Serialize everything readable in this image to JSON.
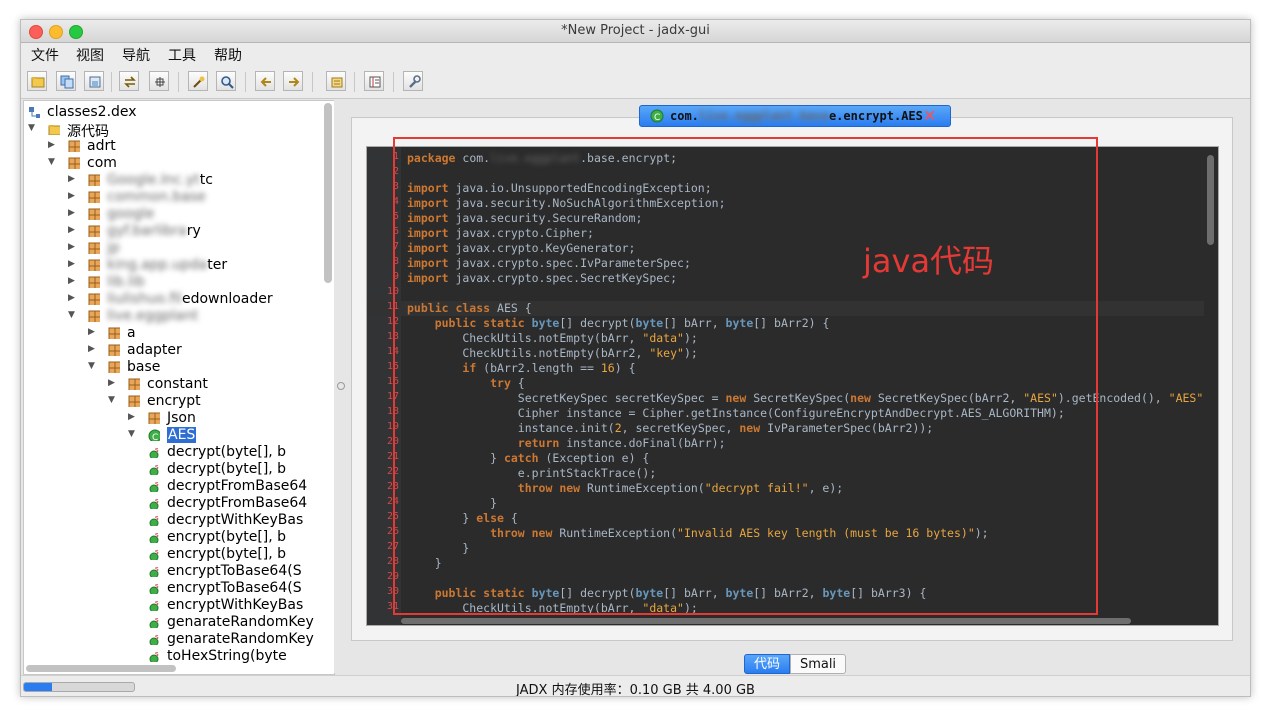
{
  "window": {
    "title": "*New Project - jadx-gui"
  },
  "menu": [
    "文件",
    "视图",
    "导航",
    "工具",
    "帮助"
  ],
  "toolbar_icons": [
    "open-folder-icon",
    "save-all-icon",
    "export-icon",
    "sync-icon",
    "flatten-icon",
    "search-text-icon",
    "search-class-icon",
    "back-icon",
    "forward-icon",
    "log-icon",
    "preferences-icon",
    "wrench-icon"
  ],
  "tree": [
    {
      "label": "classes2.dex",
      "icon": "dex-icon",
      "name": "tree-root-dex"
    },
    {
      "label": "源代码",
      "icon": "folder-open-icon",
      "name": "tree-source-root"
    },
    {
      "label": "adrt",
      "icon": "package-icon",
      "name": "tree-pkg-adrt"
    },
    {
      "label": "com",
      "icon": "package-icon",
      "name": "tree-pkg-com"
    },
    {
      "prefix": "Google.Inc.yt",
      "label": "tc",
      "icon": "package-icon",
      "name": "tree-pkg-blurred-1"
    },
    {
      "prefix": "common.base",
      "label": "",
      "icon": "package-icon",
      "name": "tree-pkg-blurred-2"
    },
    {
      "prefix": "google",
      "label": "",
      "icon": "package-icon",
      "name": "tree-pkg-blurred-3"
    },
    {
      "prefix": "gyf.barlibra",
      "label": "ry",
      "icon": "package-icon",
      "name": "tree-pkg-blurred-4"
    },
    {
      "prefix": "jp",
      "label": "",
      "icon": "package-icon",
      "name": "tree-pkg-blurred-5"
    },
    {
      "prefix": "king.app.upda",
      "label": "ter",
      "icon": "package-icon",
      "name": "tree-pkg-blurred-6"
    },
    {
      "prefix": "lib.lib",
      "label": "",
      "icon": "package-icon",
      "name": "tree-pkg-blurred-7"
    },
    {
      "prefix": "liulishuo.fil",
      "label": "edownloader",
      "icon": "package-icon",
      "name": "tree-pkg-blurred-8"
    },
    {
      "prefix": "live.eggplant",
      "label": "",
      "icon": "package-icon",
      "name": "tree-pkg-blurred-9"
    },
    {
      "label": "a",
      "icon": "package-icon",
      "name": "tree-pkg-a"
    },
    {
      "label": "adapter",
      "icon": "package-icon",
      "name": "tree-pkg-adapter"
    },
    {
      "label": "base",
      "icon": "package-icon",
      "name": "tree-pkg-base"
    },
    {
      "label": "constant",
      "icon": "package-icon",
      "name": "tree-pkg-constant"
    },
    {
      "label": "encrypt",
      "icon": "package-icon",
      "name": "tree-pkg-encrypt"
    },
    {
      "label": "Json",
      "icon": "package-icon",
      "name": "tree-pkg-json"
    },
    {
      "label": "AES",
      "icon": "class-icon",
      "name": "tree-class-aes"
    },
    {
      "label": "decrypt(byte[], b",
      "icon": "method-icon",
      "name": "tree-method"
    },
    {
      "label": "decrypt(byte[], b",
      "icon": "method-icon",
      "name": "tree-method"
    },
    {
      "label": "decryptFromBase64",
      "icon": "method-icon",
      "name": "tree-method"
    },
    {
      "label": "decryptFromBase64",
      "icon": "method-icon",
      "name": "tree-method"
    },
    {
      "label": "decryptWithKeyBas",
      "icon": "method-icon",
      "name": "tree-method"
    },
    {
      "label": "encrypt(byte[], b",
      "icon": "method-icon",
      "name": "tree-method"
    },
    {
      "label": "encrypt(byte[], b",
      "icon": "method-icon",
      "name": "tree-method"
    },
    {
      "label": "encryptToBase64(S",
      "icon": "method-icon",
      "name": "tree-method"
    },
    {
      "label": "encryptToBase64(S",
      "icon": "method-icon",
      "name": "tree-method"
    },
    {
      "label": "encryptWithKeyBas",
      "icon": "method-icon",
      "name": "tree-method"
    },
    {
      "label": "genarateRandomKey",
      "icon": "method-icon",
      "name": "tree-method"
    },
    {
      "label": "genarateRandomKey",
      "icon": "method-icon",
      "name": "tree-method"
    },
    {
      "label": "toHexString(byte",
      "icon": "method-icon",
      "name": "tree-method"
    }
  ],
  "editor_tab": {
    "prefix": "com.",
    "blurred": "live.eggplant.base",
    "suffix": "e.encrypt.AES"
  },
  "code_lines": [
    [
      [
        "kw",
        "package"
      ],
      [
        "t",
        " com."
      ],
      [
        "blur",
        "live.eggplant"
      ],
      [
        "t",
        ".base.encrypt;"
      ]
    ],
    [],
    [
      [
        "kw",
        "import"
      ],
      [
        "t",
        " java.io.UnsupportedEncodingException;"
      ]
    ],
    [
      [
        "kw",
        "import"
      ],
      [
        "t",
        " java.security.NoSuchAlgorithmException;"
      ]
    ],
    [
      [
        "kw",
        "import"
      ],
      [
        "t",
        " java.security.SecureRandom;"
      ]
    ],
    [
      [
        "kw",
        "import"
      ],
      [
        "t",
        " javax.crypto.Cipher;"
      ]
    ],
    [
      [
        "kw",
        "import"
      ],
      [
        "t",
        " javax.crypto.KeyGenerator;"
      ]
    ],
    [
      [
        "kw",
        "import"
      ],
      [
        "t",
        " javax.crypto.spec.IvParameterSpec;"
      ]
    ],
    [
      [
        "kw",
        "import"
      ],
      [
        "t",
        " javax.crypto.spec.SecretKeySpec;"
      ]
    ],
    [],
    [
      [
        "kw",
        "public class"
      ],
      [
        "t",
        " AES {"
      ]
    ],
    [
      [
        "t",
        "    "
      ],
      [
        "kw",
        "public static"
      ],
      [
        "t",
        " "
      ],
      [
        "tp",
        "byte"
      ],
      [
        "t",
        "[] decrypt("
      ],
      [
        "tp",
        "byte"
      ],
      [
        "t",
        "[] bArr, "
      ],
      [
        "tp",
        "byte"
      ],
      [
        "t",
        "[] bArr2) {"
      ]
    ],
    [
      [
        "t",
        "        CheckUtils.notEmpty(bArr, "
      ],
      [
        "str",
        "\"data\""
      ],
      [
        "t",
        ");"
      ]
    ],
    [
      [
        "t",
        "        CheckUtils.notEmpty(bArr2, "
      ],
      [
        "str",
        "\"key\""
      ],
      [
        "t",
        ");"
      ]
    ],
    [
      [
        "t",
        "        "
      ],
      [
        "kw",
        "if"
      ],
      [
        "t",
        " (bArr2.length == "
      ],
      [
        "num",
        "16"
      ],
      [
        "t",
        ") {"
      ]
    ],
    [
      [
        "t",
        "            "
      ],
      [
        "kw",
        "try"
      ],
      [
        "t",
        " {"
      ]
    ],
    [
      [
        "t",
        "                SecretKeySpec secretKeySpec = "
      ],
      [
        "kw",
        "new"
      ],
      [
        "t",
        " SecretKeySpec("
      ],
      [
        "kw",
        "new"
      ],
      [
        "t",
        " SecretKeySpec(bArr2, "
      ],
      [
        "str",
        "\"AES\""
      ],
      [
        "t",
        ").getEncoded(), "
      ],
      [
        "str",
        "\"AES\""
      ]
    ],
    [
      [
        "t",
        "                Cipher instance = Cipher.getInstance(ConfigureEncryptAndDecrypt.AES_ALGORITHM);"
      ]
    ],
    [
      [
        "t",
        "                instance.init("
      ],
      [
        "num",
        "2"
      ],
      [
        "t",
        ", secretKeySpec, "
      ],
      [
        "kw",
        "new"
      ],
      [
        "t",
        " IvParameterSpec(bArr2));"
      ]
    ],
    [
      [
        "t",
        "                "
      ],
      [
        "kw",
        "return"
      ],
      [
        "t",
        " instance.doFinal(bArr);"
      ]
    ],
    [
      [
        "t",
        "            } "
      ],
      [
        "kw",
        "catch"
      ],
      [
        "t",
        " (Exception e) {"
      ]
    ],
    [
      [
        "t",
        "                e.printStackTrace();"
      ]
    ],
    [
      [
        "t",
        "                "
      ],
      [
        "kw",
        "throw new"
      ],
      [
        "t",
        " RuntimeException("
      ],
      [
        "str",
        "\"decrypt fail!\""
      ],
      [
        "t",
        ", e);"
      ]
    ],
    [
      [
        "t",
        "            }"
      ]
    ],
    [
      [
        "t",
        "        } "
      ],
      [
        "kw",
        "else"
      ],
      [
        "t",
        " {"
      ]
    ],
    [
      [
        "t",
        "            "
      ],
      [
        "kw",
        "throw new"
      ],
      [
        "t",
        " RuntimeException("
      ],
      [
        "str",
        "\"Invalid AES key length (must be 16 bytes)\""
      ],
      [
        "t",
        ");"
      ]
    ],
    [
      [
        "t",
        "        }"
      ]
    ],
    [
      [
        "t",
        "    }"
      ]
    ],
    [],
    [
      [
        "t",
        "    "
      ],
      [
        "kw",
        "public static"
      ],
      [
        "t",
        " "
      ],
      [
        "tp",
        "byte"
      ],
      [
        "t",
        "[] decrypt("
      ],
      [
        "tp",
        "byte"
      ],
      [
        "t",
        "[] bArr, "
      ],
      [
        "tp",
        "byte"
      ],
      [
        "t",
        "[] bArr2, "
      ],
      [
        "tp",
        "byte"
      ],
      [
        "t",
        "[] bArr3) {"
      ]
    ],
    [
      [
        "t",
        "        CheckUtils.notEmpty(bArr, "
      ],
      [
        "str",
        "\"data\""
      ],
      [
        "t",
        ");"
      ]
    ]
  ],
  "annotation": {
    "label": "java代码"
  },
  "bottom_tabs": {
    "code": "代码",
    "smali": "Smali"
  },
  "status": {
    "text": "JADX 内存使用率：0.10 GB 共 4.00 GB",
    "memory_fraction": 0.025
  },
  "colors": {
    "accent": "#2a7df0",
    "annotation": "#e53935",
    "editor_bg": "#2b2b2b"
  }
}
